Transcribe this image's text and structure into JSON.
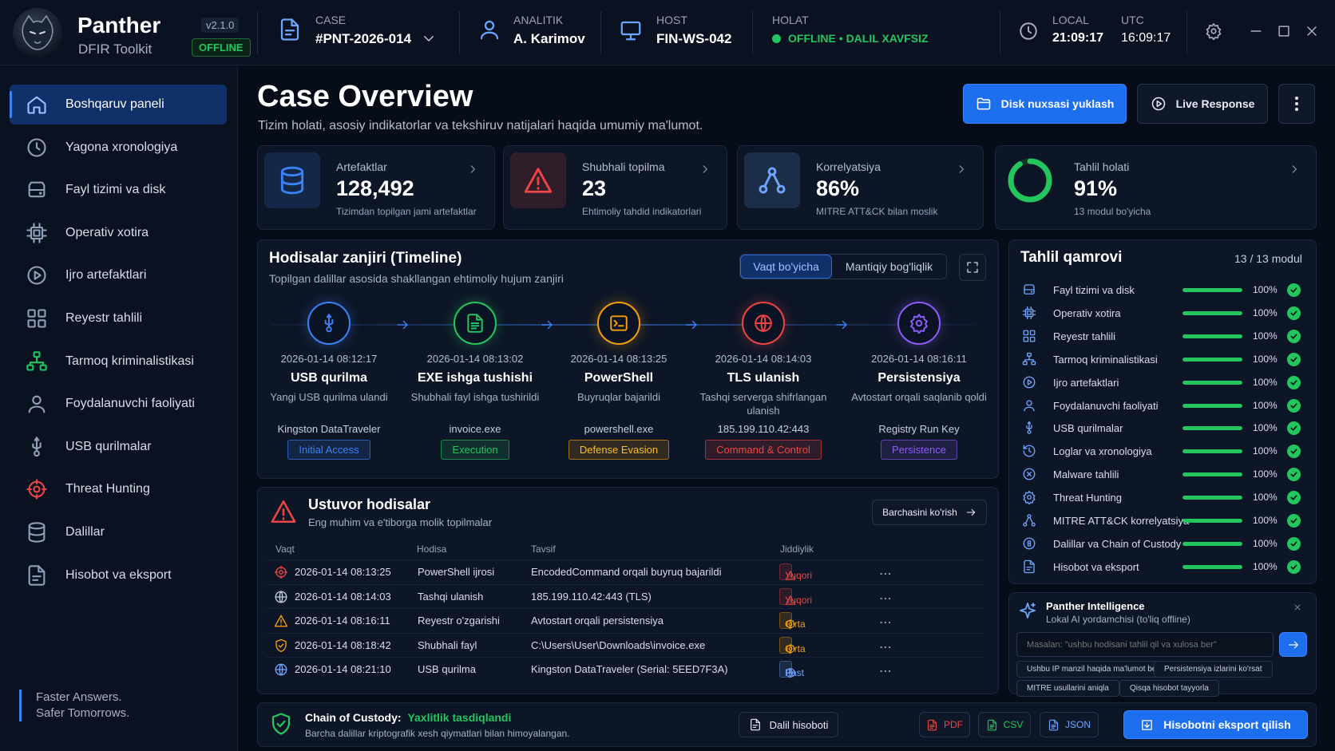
{
  "app": {
    "name": "Panther",
    "subtitle": "DFIR Toolkit",
    "version": "v2.1.0",
    "mode_badge": "OFFLINE"
  },
  "topbar": {
    "case": {
      "label": "CASE",
      "value": "#PNT-2026-014"
    },
    "analyst": {
      "label": "ANALITIK",
      "value": "A. Karimov"
    },
    "host": {
      "label": "HOST",
      "value": "FIN-WS-042"
    },
    "status": {
      "label": "HOLAT",
      "value": "OFFLINE • DALIL XAVFSIZ"
    },
    "clock": {
      "local_label": "LOCAL",
      "local": "21:09:17",
      "utc_label": "UTC",
      "utc": "16:09:17"
    }
  },
  "sidebar": {
    "items": [
      {
        "label": "Boshqaruv paneli",
        "icon": "home-icon",
        "active": true
      },
      {
        "label": "Yagona xronologiya",
        "icon": "clock-icon"
      },
      {
        "label": "Fayl tizimi va disk",
        "icon": "disk-icon"
      },
      {
        "label": "Operativ xotira",
        "icon": "chip-icon"
      },
      {
        "label": "Ijro artefaktlari",
        "icon": "play-icon"
      },
      {
        "label": "Reyestr tahlili",
        "icon": "grid-icon"
      },
      {
        "label": "Tarmoq kriminalistikasi",
        "icon": "network-icon"
      },
      {
        "label": "Foydalanuvchi faoliyati",
        "icon": "user-icon"
      },
      {
        "label": "USB qurilmalar",
        "icon": "usb-icon"
      },
      {
        "label": "Threat Hunting",
        "icon": "crosshair-icon"
      },
      {
        "label": "Dalillar",
        "icon": "database-icon"
      },
      {
        "label": "Hisobot va eksport",
        "icon": "report-icon"
      }
    ],
    "footer_line1": "Faster Answers.",
    "footer_line2": "Safer Tomorrows."
  },
  "header": {
    "title": "Case Overview",
    "subtitle": "Tizim holati, asosiy indikatorlar va tekshiruv natijalari haqida umumiy ma'lumot.",
    "upload_button": "Disk nuxsasi yuklash",
    "live_button": "Live Response"
  },
  "kpis": [
    {
      "label": "Artefaktlar",
      "value": "128,492",
      "sub": "Tizimdan topilgan jami artefaktlar",
      "icon": "database-icon",
      "color": "#3b82f6"
    },
    {
      "label": "Shubhali topilma",
      "value": "23",
      "sub": "Ehtimoliy tahdid indikatorlari",
      "icon": "warning-icon",
      "color": "#ef4444"
    },
    {
      "label": "Korrelyatsiya",
      "value": "86%",
      "sub": "MITRE ATT&CK bilan moslik",
      "icon": "graph-icon",
      "color": "#6ea6ff"
    },
    {
      "label": "Tahlil holati",
      "value": "91%",
      "sub": "13 modul bo'yicha",
      "icon": "progress-ring-icon",
      "color": "#22c55e",
      "progress": 0.91
    }
  ],
  "timeline": {
    "title": "Hodisalar zanjiri (Timeline)",
    "subtitle": "Topilgan dalillar asosida shakllangan ehtimoliy hujum zanjiri",
    "toggle": [
      "Vaqt bo'yicha",
      "Mantiqiy bog'liqlik"
    ],
    "steps": [
      {
        "time": "2026-01-14 08:12:17",
        "title": "USB qurilma",
        "desc": "Yangi USB qurilma ulandi",
        "object": "Kingston DataTraveler",
        "tag": "Initial Access",
        "icon": "usb-icon",
        "color": "#3b82f6"
      },
      {
        "time": "2026-01-14 08:13:02",
        "title": "EXE ishga tushishi",
        "desc": "Shubhali fayl ishga tushirildi",
        "object": "invoice.exe",
        "tag": "Execution",
        "icon": "file-icon",
        "color": "#22c55e"
      },
      {
        "time": "2026-01-14 08:13:25",
        "title": "PowerShell",
        "desc": "Buyruqlar bajarildi",
        "object": "powershell.exe",
        "tag": "Defense Evasion",
        "icon": "terminal-icon",
        "color": "#f59e0b"
      },
      {
        "time": "2026-01-14 08:14:03",
        "title": "TLS ulanish",
        "desc": "Tashqi serverga shifrlangan ulanish",
        "object": "185.199.110.42:443",
        "tag": "Command & Control",
        "icon": "globe-icon",
        "color": "#ef4444"
      },
      {
        "time": "2026-01-14 08:16:11",
        "title": "Persistensiya",
        "desc": "Avtostart orqali saqlanib qoldi",
        "object": "Registry Run Key",
        "tag": "Persistence",
        "icon": "gear-icon",
        "color": "#8b5cf6"
      }
    ]
  },
  "events": {
    "title": "Ustuvor hodisalar",
    "subtitle": "Eng muhim va e'tiborga molik topilmalar",
    "view_all": "Barchasini ko'rish",
    "columns": [
      "Vaqt",
      "Hodisa",
      "Tavsif",
      "Jiddiylik"
    ],
    "rows": [
      {
        "time": "2026-01-14 08:13:25",
        "event": "PowerShell ijrosi",
        "desc": "EncodedCommand orqali buyruq bajarildi",
        "severity": "Yuqori",
        "level": "high",
        "icon": "crosshair-icon"
      },
      {
        "time": "2026-01-14 08:14:03",
        "event": "Tashqi ulanish",
        "desc": "185.199.110.42:443 (TLS)",
        "severity": "Yuqori",
        "level": "high",
        "icon": "globe-icon"
      },
      {
        "time": "2026-01-14 08:16:11",
        "event": "Reyestr o'zgarishi",
        "desc": "Avtostart orqali persistensiya",
        "severity": "O'rta",
        "level": "medium",
        "icon": "warning-icon"
      },
      {
        "time": "2026-01-14 08:18:42",
        "event": "Shubhali fayl",
        "desc": "C:\\Users\\User\\Downloads\\invoice.exe",
        "severity": "O'rta",
        "level": "medium",
        "icon": "shield-icon"
      },
      {
        "time": "2026-01-14 08:21:10",
        "event": "USB qurilma",
        "desc": "Kingston DataTraveler (Serial: 5EED7F3A)",
        "severity": "Past",
        "level": "low",
        "icon": "globe-icon"
      }
    ]
  },
  "coverage": {
    "title": "Tahlil qamrovi",
    "count": "13 / 13 modul",
    "modules": [
      {
        "label": "Fayl tizimi va disk",
        "pct": "100%",
        "value": 1.0,
        "icon": "disk-icon"
      },
      {
        "label": "Operativ xotira",
        "pct": "100%",
        "value": 1.0,
        "icon": "chip-icon"
      },
      {
        "label": "Reyestr tahlili",
        "pct": "100%",
        "value": 1.0,
        "icon": "grid-icon"
      },
      {
        "label": "Tarmoq kriminalistikasi",
        "pct": "100%",
        "value": 1.0,
        "icon": "network-icon"
      },
      {
        "label": "Ijro artefaktlari",
        "pct": "100%",
        "value": 1.0,
        "icon": "play-icon"
      },
      {
        "label": "Foydalanuvchi faoliyati",
        "pct": "100%",
        "value": 1.0,
        "icon": "user-icon"
      },
      {
        "label": "USB qurilmalar",
        "pct": "100%",
        "value": 1.0,
        "icon": "usb-icon"
      },
      {
        "label": "Loglar va xronologiya",
        "pct": "100%",
        "value": 1.0,
        "icon": "history-icon"
      },
      {
        "label": "Malware tahlili",
        "pct": "100%",
        "value": 1.0,
        "icon": "malware-icon"
      },
      {
        "label": "Threat Hunting",
        "pct": "100%",
        "value": 1.0,
        "icon": "gear-icon"
      },
      {
        "label": "MITRE ATT&CK korrelyatsiya",
        "pct": "100%",
        "value": 1.0,
        "icon": "graph-icon"
      },
      {
        "label": "Dalillar va Chain of Custody",
        "pct": "100%",
        "value": 1.0,
        "icon": "custody-icon"
      },
      {
        "label": "Hisobot va eksport",
        "pct": "100%",
        "value": 1.0,
        "icon": "report-icon"
      }
    ]
  },
  "ai": {
    "title": "Panther Intelligence",
    "subtitle": "Lokal AI yordamchisi (to'liq offline)",
    "placeholder": "Masalan: \"ushbu hodisani tahlil qil va xulosa ber\"",
    "chips": [
      "Ushbu IP manzil haqida ma'lumot ber",
      "Persistensiya izlarini ko'rsat",
      "MITRE usullarini aniqla",
      "Qisqa hisobot tayyorla"
    ]
  },
  "custody": {
    "label": "Chain of Custody:",
    "status": "Yaxlitlik tasdiqlandi",
    "note": "Barcha dalillar kriptografik xesh qiymatlari bilan himoyalangan.",
    "report_button": "Dalil hisoboti",
    "pdf": "PDF",
    "csv": "CSV",
    "json": "JSON",
    "export_button": "Hisobotni eksport qilish"
  },
  "colors": {
    "accent": "#1e6ff0",
    "success": "#22c55e",
    "danger": "#ef4444",
    "warning": "#f59e0b",
    "bg": "#070d18"
  }
}
